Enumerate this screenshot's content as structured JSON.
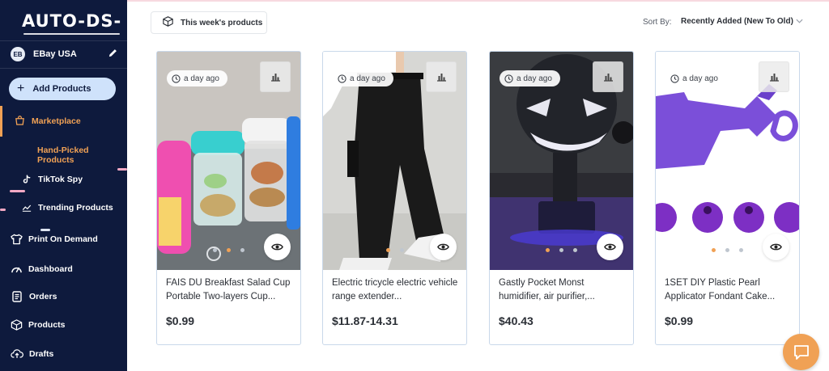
{
  "brand": {
    "logo_text": "AUTO-DS-"
  },
  "store": {
    "badge": "EB",
    "name": "EBay USA"
  },
  "sidebar": {
    "add_products": "Add Products",
    "items": [
      {
        "label": "Marketplace"
      },
      {
        "label": "Hand-Picked Products"
      },
      {
        "label": "TikTok Spy"
      },
      {
        "label": "Trending Products"
      },
      {
        "label": "Print On Demand"
      },
      {
        "label": "Dashboard"
      },
      {
        "label": "Orders"
      },
      {
        "label": "Products"
      },
      {
        "label": "Drafts"
      }
    ]
  },
  "toolbar": {
    "weekly_label": "This week's products",
    "sort_label": "Sort By:",
    "sort_value": "Recently Added (New To Old)"
  },
  "colors": {
    "sidebar_bg": "#0e1a3d",
    "accent": "#f0a155",
    "add_button_bg": "#cfe2fb"
  },
  "products": [
    {
      "time": "a day ago",
      "title": "FAIS DU Breakfast Salad Cup Portable Two-layers Cup...",
      "price": "$0.99",
      "dots_count": 3,
      "active_dot": 1
    },
    {
      "time": "a day ago",
      "title": "Electric tricycle electric vehicle range extender...",
      "price": "$11.87-14.31",
      "dots_count": 2,
      "active_dot": 0
    },
    {
      "time": "a day ago",
      "title": "Gastly Pocket Monst humidifier, air purifier,...",
      "price": "$40.43",
      "dots_count": 3,
      "active_dot": 0
    },
    {
      "time": "a day ago",
      "title": "1SET DIY Plastic Pearl Applicator Fondant Cake...",
      "price": "$0.99",
      "dots_count": 3,
      "active_dot": 0
    }
  ]
}
